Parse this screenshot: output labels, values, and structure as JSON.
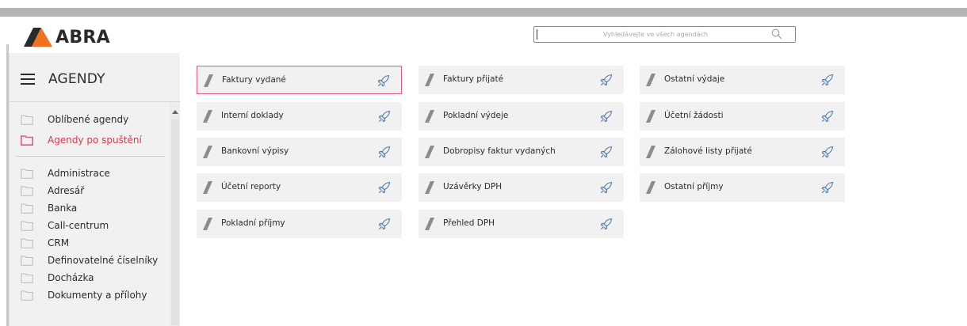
{
  "brand": {
    "name": "ABRA",
    "accent": "#e05a7a",
    "logo_orange": "#f07020"
  },
  "search": {
    "placeholder": "Vyhledávejte ve všech agendách"
  },
  "sidebar": {
    "title": "AGENDY",
    "items": [
      {
        "label": "Oblíbené agendy",
        "icon": "folder-icon",
        "active": false
      },
      {
        "label": "Agendy po spuštění",
        "icon": "folder-icon",
        "active": true
      },
      {
        "label": "Administrace",
        "icon": "folder-icon",
        "active": false
      },
      {
        "label": "Adresář",
        "icon": "folder-icon",
        "active": false
      },
      {
        "label": "Banka",
        "icon": "folder-icon",
        "active": false
      },
      {
        "label": "Call-centrum",
        "icon": "folder-icon",
        "active": false
      },
      {
        "label": "CRM",
        "icon": "folder-icon",
        "active": false
      },
      {
        "label": "Definovatelné číselníky",
        "icon": "folder-icon",
        "active": false
      },
      {
        "label": "Docházka",
        "icon": "folder-icon",
        "active": false
      },
      {
        "label": "Dokumenty a přílohy",
        "icon": "folder-icon",
        "active": false
      }
    ]
  },
  "tiles": [
    {
      "label": "Faktury vydané",
      "icon": "rocket-icon",
      "selected": true
    },
    {
      "label": "Faktury přijaté",
      "icon": "rocket-icon",
      "selected": false
    },
    {
      "label": "Ostatní výdaje",
      "icon": "rocket-icon",
      "selected": false
    },
    {
      "label": "Interní doklady",
      "icon": "rocket-icon",
      "selected": false
    },
    {
      "label": "Pokladní výdeje",
      "icon": "rocket-icon",
      "selected": false
    },
    {
      "label": "Účetní žádosti",
      "icon": "rocket-icon",
      "selected": false
    },
    {
      "label": "Bankovní výpisy",
      "icon": "rocket-icon",
      "selected": false
    },
    {
      "label": "Dobropisy faktur vydaných",
      "icon": "rocket-icon",
      "selected": false
    },
    {
      "label": "Zálohové listy přijaté",
      "icon": "rocket-icon",
      "selected": false
    },
    {
      "label": "Účetní reporty",
      "icon": "rocket-icon",
      "selected": false
    },
    {
      "label": "Uzávěrky DPH",
      "icon": "rocket-icon",
      "selected": false
    },
    {
      "label": "Ostatní příjmy",
      "icon": "rocket-icon",
      "selected": false
    },
    {
      "label": "Pokladní příjmy",
      "icon": "rocket-icon",
      "selected": false
    },
    {
      "label": "Přehled DPH",
      "icon": "rocket-icon",
      "selected": false
    }
  ]
}
